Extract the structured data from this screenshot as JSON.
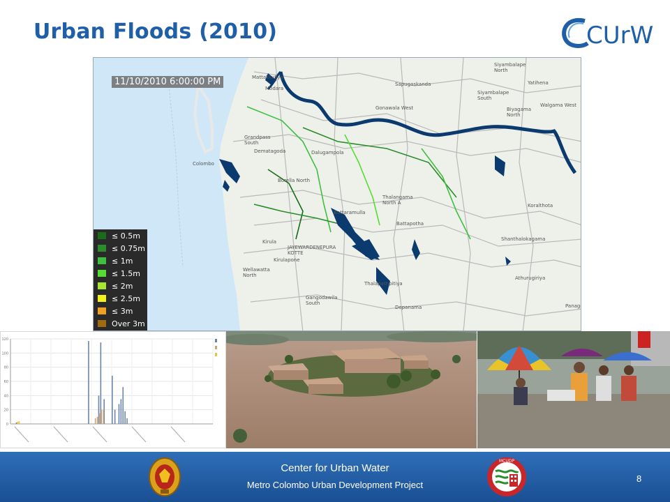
{
  "slide": {
    "title": "Urban Floods",
    "year": "(2010)",
    "logo_text": "CUrW",
    "page_number": "8"
  },
  "map": {
    "timestamp": "11/10/2010 6:00:00 PM",
    "legend": [
      {
        "label": "≤ 0.5m",
        "color": "#1a6b1a"
      },
      {
        "label": "≤ 0.75m",
        "color": "#2a8c2a"
      },
      {
        "label": "≤ 1m",
        "color": "#3fbf3f"
      },
      {
        "label": "≤ 1.5m",
        "color": "#55dd33"
      },
      {
        "label": "≤ 2m",
        "color": "#a6e632"
      },
      {
        "label": "≤ 2.5m",
        "color": "#f2f21a"
      },
      {
        "label": "≤ 3m",
        "color": "#f0a020"
      },
      {
        "label": "Over 3m",
        "color": "#a06a10"
      }
    ],
    "places": {
      "mattakkuliya": "Mattakkuliya",
      "modara": "Modara",
      "sapugaskanda": "Sapugaskanda",
      "siyambalape_north": "Siyambalape North",
      "siyambalape_south": "Siyambalape South",
      "yatihena": "Yatihena",
      "biyagama_north": "Biyagama North",
      "walgama_west": "Walgama West",
      "gonawala_west": "Gonawala West",
      "grandpass_south": "Grandpass South",
      "dematagoda": "Dematagoda",
      "dalugampola": "Dalugampola",
      "colombo": "Colombo",
      "borella_north": "Borella North",
      "thalangama_north": "Thalangama North A",
      "battaramulla": "Battaramulla",
      "battapotha": "Battapotha",
      "koralthota": "Koralthota",
      "kirula": "Kirula",
      "jayewardenepura": "JAYEWARDENEPURA KOTTE",
      "shanthalokagama": "Shanthalokagama",
      "kirulapone": "Kirulapone",
      "wellawatta_north": "Wellawatta North",
      "athurugiriya": "Athurugiriya",
      "thalapathpitiya": "Thalapathpitiya",
      "gangodawila_south": "Gangodawila South",
      "depanama": "Depanama",
      "panagoda": "Panago"
    }
  },
  "footer": {
    "title": "Center for Urban Water",
    "subtitle": "Metro Colombo Urban Development Project",
    "mcudp_badge": "MCUDP"
  },
  "chart_data": {
    "type": "bar",
    "ylim": [
      0,
      120
    ],
    "yticks": [
      "0",
      "20",
      "40",
      "60",
      "80",
      "100",
      "120"
    ],
    "series": [
      {
        "color": "#6b85a8",
        "values": [
          [
            8,
            2
          ],
          [
            115,
            117
          ],
          [
            130,
            40
          ],
          [
            133,
            115
          ],
          [
            138,
            35
          ],
          [
            150,
            68
          ],
          [
            154,
            20
          ],
          [
            160,
            28
          ],
          [
            163,
            35
          ],
          [
            166,
            52
          ],
          [
            169,
            18
          ],
          [
            172,
            8
          ]
        ]
      },
      {
        "color": "#c9a37a",
        "values": [
          [
            125,
            8
          ],
          [
            128,
            10
          ],
          [
            131,
            15
          ],
          [
            134,
            20
          ],
          [
            137,
            20
          ]
        ]
      },
      {
        "color": "#f0c040",
        "values": [
          [
            10,
            3
          ],
          [
            12,
            4
          ]
        ]
      }
    ]
  }
}
